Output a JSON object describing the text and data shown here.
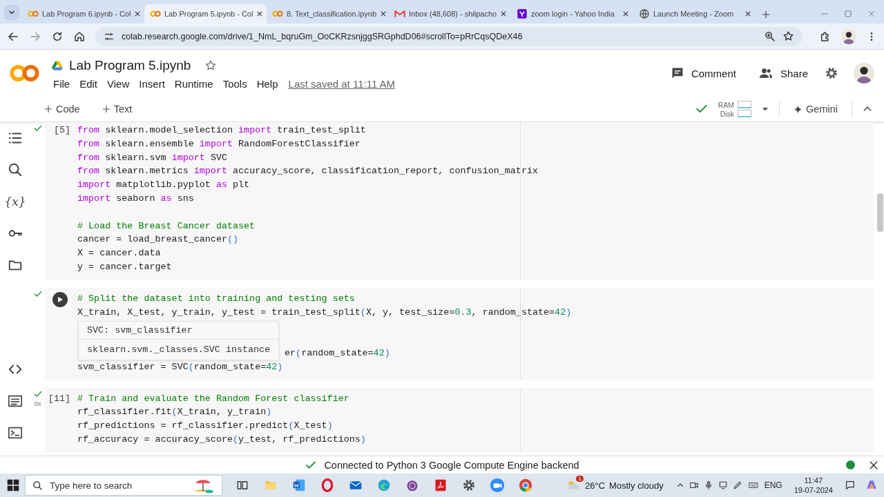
{
  "browser": {
    "tabs": [
      {
        "title": "Lab Program 6.ipynb - Col",
        "kind": "notebook",
        "selected": false
      },
      {
        "title": "Lab Program 5.ipynb - Col",
        "kind": "notebook",
        "selected": true
      },
      {
        "title": "8. Text_classification.ipynb",
        "kind": "notebook",
        "selected": false
      },
      {
        "title": "Inbox (48,608) - shilpacho",
        "kind": "mail",
        "selected": false
      },
      {
        "title": "zoom login - Yahoo India",
        "kind": "search",
        "selected": false
      },
      {
        "title": "Launch Meeting - Zoom",
        "kind": "web",
        "selected": false
      }
    ],
    "url": "colab.research.google.com/drive/1_NmL_bqruGm_OoCKRzsnjggSRGphdD06#scrollTo=pRrCqsQDeX46"
  },
  "header": {
    "title": "Lab Program 5.ipynb",
    "menu": [
      "File",
      "Edit",
      "View",
      "Insert",
      "Runtime",
      "Tools",
      "Help"
    ],
    "last_saved": "Last saved at 11:11 AM",
    "comment": "Comment",
    "share": "Share"
  },
  "toolbar": {
    "add_code": "Code",
    "add_text": "Text",
    "ram": "RAM",
    "disk": "Disk",
    "gemini": "Gemini"
  },
  "rail": {
    "variables_glyph": "{x}"
  },
  "cells": [
    {
      "execution_count": "[5]",
      "hovered": false,
      "succeeded": true,
      "lines": [
        {
          "kind": "code",
          "segments": [
            {
              "kind": "kw",
              "text": "from"
            },
            {
              "kind": "tx",
              "text": " sklearn.model_selection "
            },
            {
              "kind": "kw",
              "text": "import"
            },
            {
              "kind": "tx",
              "text": " train_test_split"
            }
          ]
        },
        {
          "kind": "code",
          "segments": [
            {
              "kind": "kw",
              "text": "from"
            },
            {
              "kind": "tx",
              "text": " sklearn.ensemble "
            },
            {
              "kind": "kw",
              "text": "import"
            },
            {
              "kind": "tx",
              "text": " RandomForestClassifier"
            }
          ]
        },
        {
          "kind": "code",
          "segments": [
            {
              "kind": "kw",
              "text": "from"
            },
            {
              "kind": "tx",
              "text": " sklearn.svm "
            },
            {
              "kind": "kw",
              "text": "import"
            },
            {
              "kind": "tx",
              "text": " SVC"
            }
          ]
        },
        {
          "kind": "code",
          "segments": [
            {
              "kind": "kw",
              "text": "from"
            },
            {
              "kind": "tx",
              "text": " sklearn.metrics "
            },
            {
              "kind": "kw",
              "text": "import"
            },
            {
              "kind": "tx",
              "text": " accuracy_score, classification_report, confusion_matrix"
            }
          ]
        },
        {
          "kind": "code",
          "segments": [
            {
              "kind": "kw",
              "text": "import"
            },
            {
              "kind": "tx",
              "text": " matplotlib.pyplot "
            },
            {
              "kind": "kw",
              "text": "as"
            },
            {
              "kind": "tx",
              "text": " plt"
            }
          ]
        },
        {
          "kind": "code",
          "segments": [
            {
              "kind": "kw",
              "text": "import"
            },
            {
              "kind": "tx",
              "text": " seaborn "
            },
            {
              "kind": "kw",
              "text": "as"
            },
            {
              "kind": "tx",
              "text": " sns"
            }
          ]
        },
        {
          "kind": "blank"
        },
        {
          "kind": "code",
          "segments": [
            {
              "kind": "cm",
              "text": "# Load the Breast Cancer dataset"
            }
          ]
        },
        {
          "kind": "code",
          "segments": [
            {
              "kind": "tx",
              "text": "cancer = load_breast_cancer"
            },
            {
              "kind": "br",
              "text": "()"
            }
          ]
        },
        {
          "kind": "code",
          "segments": [
            {
              "kind": "tx",
              "text": "X = cancer.data"
            }
          ]
        },
        {
          "kind": "code",
          "segments": [
            {
              "kind": "tx",
              "text": "y = cancer.target"
            }
          ]
        }
      ]
    },
    {
      "hovered": true,
      "succeeded": true,
      "tooltip": {
        "title": "SVC: svm_classifier",
        "detail": "sklearn.svm._classes.SVC instance"
      },
      "lines": [
        {
          "kind": "code",
          "segments": [
            {
              "kind": "cm",
              "text": "# Split the dataset into training and testing sets"
            }
          ]
        },
        {
          "kind": "code",
          "segments": [
            {
              "kind": "tx",
              "text": "X_train, X_test, y_train, y_test = train_test_split"
            },
            {
              "kind": "br",
              "text": "("
            },
            {
              "kind": "tx",
              "text": "X, y, test_size="
            },
            {
              "kind": "num",
              "text": "0.3"
            },
            {
              "kind": "tx",
              "text": ", random_state="
            },
            {
              "kind": "num",
              "text": "42"
            },
            {
              "kind": "br",
              "text": ")"
            }
          ]
        },
        {
          "kind": "blank"
        },
        {
          "kind": "blank"
        },
        {
          "kind": "partial",
          "segments": [
            {
              "kind": "tx",
              "text": "er"
            },
            {
              "kind": "br",
              "text": "("
            },
            {
              "kind": "tx",
              "text": "random_state="
            },
            {
              "kind": "num",
              "text": "42"
            },
            {
              "kind": "br",
              "text": ")"
            }
          ]
        },
        {
          "kind": "code",
          "segments": [
            {
              "kind": "tx",
              "text": "svm_classifier = SVC"
            },
            {
              "kind": "br",
              "text": "("
            },
            {
              "kind": "tx",
              "text": "random_state="
            },
            {
              "kind": "num",
              "text": "42"
            },
            {
              "kind": "br",
              "text": ")"
            }
          ]
        }
      ]
    },
    {
      "execution_count": "[11]",
      "run_time": "0s",
      "hovered": false,
      "succeeded": true,
      "lines": [
        {
          "kind": "code",
          "segments": [
            {
              "kind": "cm",
              "text": "# Train and evaluate the Random Forest classifier"
            }
          ]
        },
        {
          "kind": "code",
          "segments": [
            {
              "kind": "tx",
              "text": "rf_classifier.fit"
            },
            {
              "kind": "br",
              "text": "("
            },
            {
              "kind": "tx",
              "text": "X_train, y_train"
            },
            {
              "kind": "br",
              "text": ")"
            }
          ]
        },
        {
          "kind": "code",
          "segments": [
            {
              "kind": "tx",
              "text": "rf_predictions = rf_classifier.predict"
            },
            {
              "kind": "br",
              "text": "("
            },
            {
              "kind": "tx",
              "text": "X_test"
            },
            {
              "kind": "br",
              "text": ")"
            }
          ]
        },
        {
          "kind": "code",
          "segments": [
            {
              "kind": "tx",
              "text": "rf_accuracy = accuracy_score"
            },
            {
              "kind": "br",
              "text": "("
            },
            {
              "kind": "tx",
              "text": "y_test, rf_predictions"
            },
            {
              "kind": "br",
              "text": ")"
            }
          ]
        }
      ]
    }
  ],
  "status_bar": {
    "message": "Connected to Python 3 Google Compute Engine backend"
  },
  "taskbar": {
    "search_placeholder": "Type here to search",
    "weather_badge": "1",
    "temperature": "26°C",
    "conditions": "Mostly cloudy",
    "language": "ENG",
    "time": "11:47",
    "date": "19-07-2024"
  }
}
